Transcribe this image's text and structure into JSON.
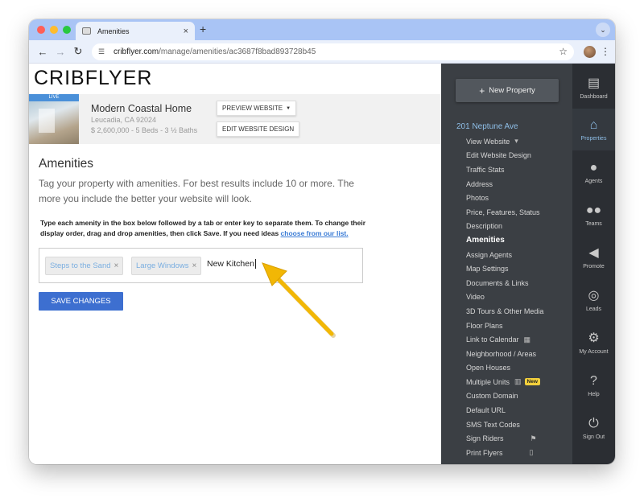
{
  "browser": {
    "tab_title": "Amenities",
    "tab_close": "×",
    "new_tab": "+",
    "tab_menu": "⌄",
    "url_host": "cribflyer.com",
    "url_path": "/manage/amenities/ac3687f8bad893728b45"
  },
  "brand": {
    "logo": "CRIBFLYER"
  },
  "property": {
    "status_badge": "LIVE",
    "title": "Modern Coastal Home",
    "location": "Leucadia, CA 92024",
    "specs": "$ 2,600,000 - 5 Beds - 3 ½ Baths",
    "preview_button": "PREVIEW WEBSITE",
    "edit_design_button": "EDIT WEBSITE DESIGN"
  },
  "amenities": {
    "heading": "Amenities",
    "subtitle": "Tag your property with amenities. For best results include 10 or more. The more you include the better your website will look.",
    "help_text": "Type each amenity in the box below followed by a tab or enter key to separate them. To change their display order, drag and drop amenities, then click Save. If you need ideas ",
    "help_link": "choose from our list.",
    "tags": [
      "Steps to the Sand",
      "Large Windows"
    ],
    "tag_remove": "×",
    "input_value": "New Kitchen",
    "save_button": "SAVE CHANGES"
  },
  "sidenav": {
    "new_property_button": "New Property",
    "property_address": "201 Neptune Ave",
    "menu": [
      "View Website",
      "Edit Website Design",
      "Traffic Stats",
      "Address",
      "Photos",
      "Price, Features, Status",
      "Description",
      "Amenities",
      "Assign Agents",
      "Map Settings",
      "Documents & Links",
      "Video",
      "3D Tours & Other Media",
      "Floor Plans",
      "Link to Calendar",
      "Neighborhood / Areas",
      "Open Houses",
      "Multiple Units",
      "Custom Domain",
      "Default URL",
      "SMS Text Codes",
      "Sign Riders",
      "Print Flyers"
    ],
    "active_item": "Amenities",
    "new_badge": "New"
  },
  "iconbar": [
    {
      "label": "Dashboard",
      "icon": "dashboard-icon"
    },
    {
      "label": "Properties",
      "icon": "properties-icon"
    },
    {
      "label": "Agents",
      "icon": "agents-icon"
    },
    {
      "label": "Teams",
      "icon": "teams-icon"
    },
    {
      "label": "Promote",
      "icon": "megaphone-icon"
    },
    {
      "label": "Leads",
      "icon": "target-icon"
    },
    {
      "label": "My Account",
      "icon": "gear-icon"
    },
    {
      "label": "Help",
      "icon": "help-icon"
    },
    {
      "label": "Sign Out",
      "icon": "power-icon"
    }
  ],
  "colors": {
    "accent": "#3d6fd0",
    "link": "#3a7bd5",
    "sidebar": "#3b3f44",
    "iconbar": "#2b2e33",
    "tab_strip": "#a9c4f5",
    "arrow": "#f2b705",
    "new_badge": "#f3d03c"
  }
}
